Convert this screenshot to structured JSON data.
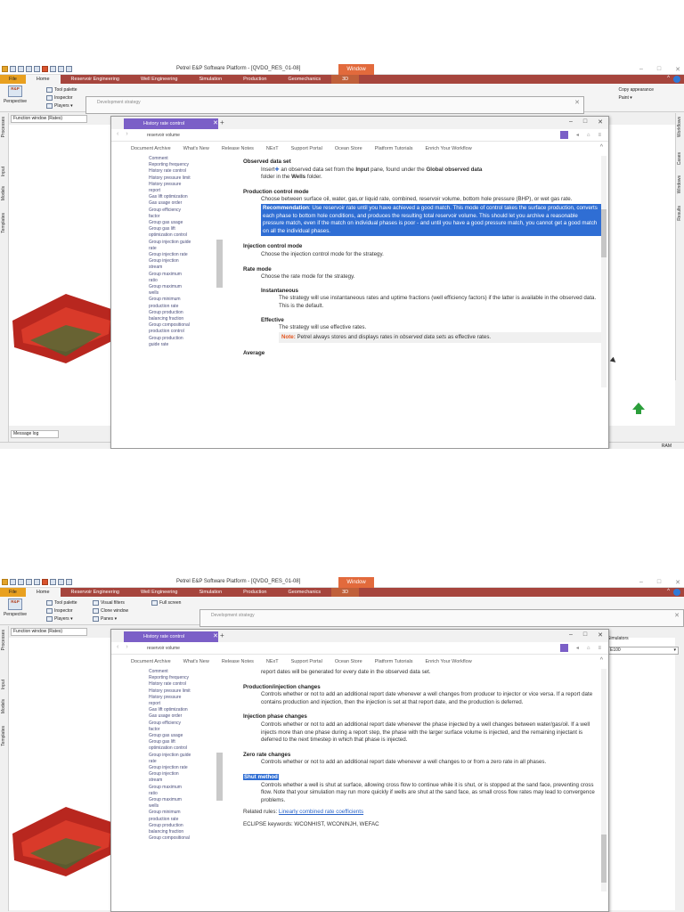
{
  "app": {
    "title": "Petrel E&P Software Platform - [QVDO_RES_01-08]",
    "context_tab": "Window"
  },
  "ribbon": {
    "tabs": [
      "File",
      "Home",
      "Reservoir Engineering",
      "Well Engineering",
      "Simulation",
      "Production",
      "Geomechanics",
      "3D"
    ],
    "perspective_label": "Perspective",
    "rp_logo": "R&P",
    "tools_col1": [
      "Tool palette",
      "Inspector",
      "Players"
    ],
    "tools_col2": [
      "Visual filters",
      "Clone window",
      "Panes"
    ],
    "tools_col3": [
      "Full screen"
    ],
    "right_tools": [
      "Copy appearance",
      "Paint"
    ]
  },
  "left_tabs": [
    "Processes",
    "Input",
    "Models",
    "Templates"
  ],
  "right_tabs": [
    "Workflows",
    "Cases",
    "Windows",
    "Results"
  ],
  "function_window": "Function window (Rates)",
  "message_log": "Message log",
  "status": {
    "ram": "RAM"
  },
  "dev_strategy": {
    "title": "Development strategy"
  },
  "simulators": {
    "label": "Simulators",
    "value": "E100"
  },
  "help": {
    "tab_title": "History rate control",
    "address": "reservoir volume",
    "menu": [
      "Document Archive",
      "What's New",
      "Release Notes",
      "NExT",
      "Support Portal",
      "Ocean Store",
      "Platform Tutorials",
      "Enrich Your Workflow"
    ],
    "toc": [
      "Comment",
      "Reporting frequency",
      "History rate control",
      "History pressure limit",
      "History pressure",
      "report",
      "Gas lift optimization",
      "Gas usage order",
      "Group efficiency",
      "factor",
      "Group gas usage",
      "Group gas lift",
      "optimization control",
      "Group injection guide",
      "rate",
      "Group injection rate",
      "Group injection",
      "stream",
      "Group maximum",
      "ratio",
      "Group maximum",
      "wells",
      "Group minimum",
      "production rate",
      "Group production",
      "balancing fraction",
      "Group compositional",
      "production control",
      "Group production",
      "guide rate"
    ]
  },
  "content1": {
    "h_observed": "Observed data set",
    "observed_1": "Insert",
    "observed_2": " an observed data set from the ",
    "observed_3": "Input",
    "observed_4": " pane, found under the ",
    "observed_5": "Global observed data",
    "observed_6": "folder in the ",
    "observed_7": "Wells",
    "observed_8": " folder.",
    "h_production_control": "Production control mode",
    "production_control": "Choose between surface oil, water, gas,or liquid rate, combined, reservoir volume, bottom hole pressure (BHP), or wet gas rate.",
    "rec_label": "Recommendation",
    "rec_text": ": Use reservoir rate until you have achieved a good match. This mode of control takes the surface production, converts each phase to bottom hole conditions, and produces the resulting total reservoir volume. This should let you archive a reasonable pressure match, even if the match on individual phases is poor - and until you have a good pressure match, you cannot get a good match on all the individual phases.",
    "h_injection_control": "Injection control mode",
    "injection_control": "Choose the injection control mode for the strategy.",
    "h_rate_mode": "Rate mode",
    "rate_mode": "Choose the rate mode for the strategy.",
    "h_instantaneous": "Instantaneous",
    "instantaneous": "The strategy will use instantaneous rates and uptime fractions (well efficiency factors) if the latter is available in the observed data. This is the default.",
    "h_effective": "Effective",
    "effective": "The strategy will use effective rates.",
    "note_label": "Note:",
    "note_1": " Petrel always stores and displays rates in ",
    "note_2": "observed data sets",
    "note_3": " as effective rates.",
    "h_average": "Average"
  },
  "content2": {
    "top_line": "report dates will be generated for every date in the observed data set.",
    "h_prod_inj": "Production/injection changes",
    "prod_inj": "Controls whether or not to add an additional report date whenever a well changes from producer to injector or vice versa. If a report date contains production and injection, then the injection is set at that report date, and the production is deferred.",
    "h_inj_phase": "Injection phase changes",
    "inj_phase": "Controls whether or not to add an additional report date whenever the phase injected by a well changes between water/gas/oil. If a well injects more than one phase during a report step, the phase with the larger surface volume is injected, and the remaining injectant is deferred to the next timestep in which that phase is injected.",
    "h_zero_rate": "Zero rate changes",
    "zero_rate": "Controls whether or not to add an additional report date whenever a well changes to or from a zero rate in all phases.",
    "h_shut": "Shut method",
    "shut": "Controls whether a well is shut at surface, allowing cross flow to continue while it is shut, or is stopped at the sand face, preventing cross flow. Note that your simulation may run more quickly if wells are shut at the sand face, as small cross flow rates may lead to convergence problems.",
    "related_label": "Related rules: ",
    "related_link": "Linearly combined rate coefficients",
    "eclipse": "ECLIPSE keywords: WCONHIST, WCONINJH, WEFAC"
  }
}
